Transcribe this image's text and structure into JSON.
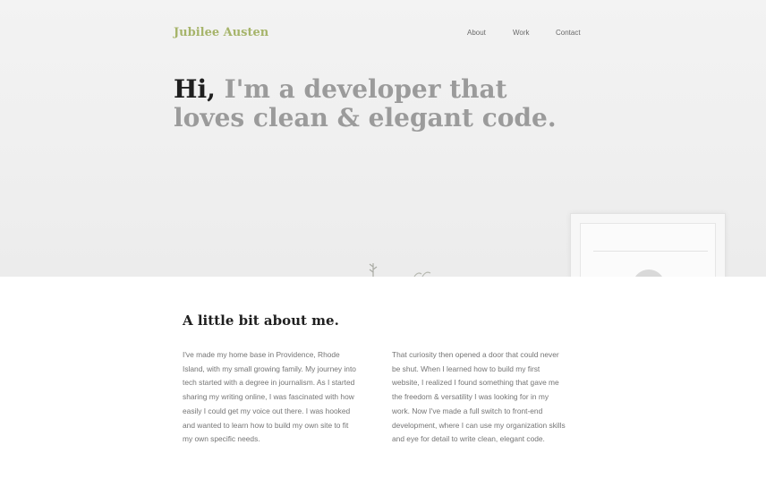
{
  "header": {
    "brand": "Jubilee Austen",
    "nav": [
      "About",
      "Work",
      "Contact"
    ]
  },
  "hero": {
    "title_hi": "Hi,",
    "title_rest": " I'm a developer that loves clean & elegant code."
  },
  "about": {
    "title": "A little bit about me.",
    "paragraph_left": "I've made my home base in Providence, Rhode Island, with my small growing family. My journey into tech started with a degree in journalism. As I started sharing my writing online, I was fascinated with how easily I could get my voice out there. I was hooked and wanted to learn how to build my own site to fit my own specific needs.",
    "paragraph_right": "That curiosity then opened a door that could never be shut. When I learned how to build my first website, I realized I found something that gave me the freedom & versatility I was looking for in my work. Now I've made a full switch to front-end development, where I can use my organization skills and eye for detail to write clean, elegant code."
  },
  "colors": {
    "brand": "#a6b46a",
    "heading_dark": "#1f1f1f",
    "heading_gray": "#9b9b9b",
    "body_text": "#757575"
  }
}
